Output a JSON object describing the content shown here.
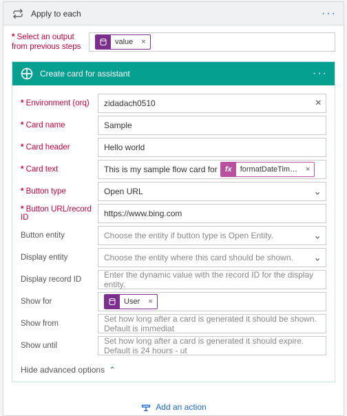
{
  "applyHeader": {
    "title": "Apply to each"
  },
  "selectOutput": {
    "label": "Select an output from previous steps",
    "pill": "value"
  },
  "createCard": {
    "title": "Create card for assistant",
    "fields": {
      "env_label": "Environment (orq)",
      "env_value": "zidadach0510",
      "name_label": "Card name",
      "name_value": "Sample",
      "header_label": "Card header",
      "header_value": "Hello world",
      "text_label": "Card text",
      "text_prefix": "This is my sample flow card for",
      "text_fx": "formatDateTim…",
      "btntype_label": "Button type",
      "btntype_value": "Open URL",
      "url_label": "Button URL/record ID",
      "url_value": "https://www.bing.com",
      "btnentity_label": "Button entity",
      "btnentity_ph": "Choose the entity if button type is Open Entity.",
      "dispentity_label": "Display entity",
      "dispentity_ph": "Choose the entity where this card should be shown.",
      "disprec_label": "Display record ID",
      "disprec_ph": "Enter the dynamic value with the record ID for the display entity.",
      "showfor_label": "Show for",
      "showfor_pill": "User",
      "showfrom_label": "Show from",
      "showfrom_ph": "Set how long after a card is generated it should be shown. Default is immediat",
      "showuntil_label": "Show until",
      "showuntil_ph": "Set how long after a card is generated it should expire. Default is 24 hours - ut"
    },
    "hideAdvanced": "Hide advanced options"
  },
  "addAction": "Add an action"
}
